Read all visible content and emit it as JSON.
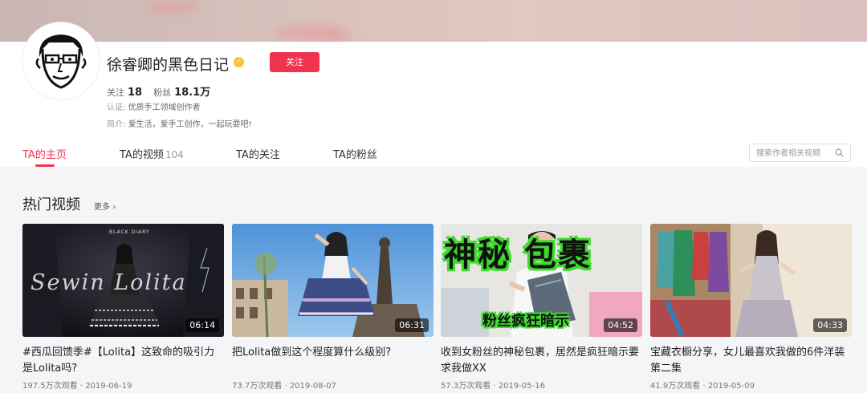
{
  "profile": {
    "name": "徐睿卿的黑色日记",
    "follow_button": "关注",
    "following_label": "关注",
    "following_count": "18",
    "fans_label": "粉丝",
    "fans_count": "18.1万",
    "cert_label": "认证:",
    "cert_value": "优质手工领域创作者",
    "bio_label": "简介:",
    "bio_value": "爱生活，爱手工创作，一起玩耍吧!"
  },
  "tabs": [
    {
      "label": "TA的主页",
      "count": ""
    },
    {
      "label": "TA的视频",
      "count": "104"
    },
    {
      "label": "TA的关注",
      "count": ""
    },
    {
      "label": "TA的粉丝",
      "count": ""
    }
  ],
  "search": {
    "placeholder": "搜索作者相关视频"
  },
  "section": {
    "title": "热门视频",
    "more": "更多 ›"
  },
  "videos": [
    {
      "title": "#西瓜回馈季#【Lolita】这致命的吸引力是Lolita吗?",
      "duration": "06:14",
      "views": "197.5万次观看",
      "date": "2019-06-19"
    },
    {
      "title": "把Lolita做到这个程度算什么级别?",
      "duration": "06:31",
      "views": "73.7万次观看",
      "date": "2019-08-07"
    },
    {
      "title": "收到女粉丝的神秘包裹，居然是疯狂暗示要求我做XX",
      "duration": "04:52",
      "views": "57.3万次观看",
      "date": "2019-05-16"
    },
    {
      "title": "宝藏衣橱分享，女儿最喜欢我做的6件洋装第二集",
      "duration": "04:33",
      "views": "41.9万次观看",
      "date": "2019-05-09"
    }
  ],
  "thumb_text": {
    "v1_top": "BLACK DIARY",
    "v1_overlay": "Sewin Lolita",
    "v3_top": "神秘 包裹",
    "v3_bottom": "粉丝疯狂暗示"
  },
  "colors": {
    "accent": "#f0344f",
    "verify": "#f5c43a"
  }
}
